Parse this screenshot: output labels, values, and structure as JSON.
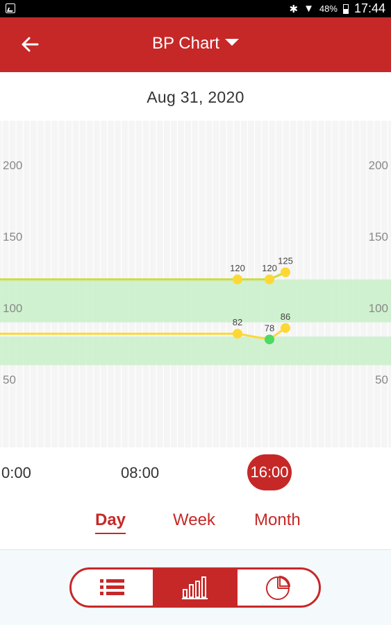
{
  "status_bar": {
    "battery": "48%",
    "time": "17:44"
  },
  "header": {
    "title": "BP Chart"
  },
  "date": "Aug 31, 2020",
  "chart_data": {
    "type": "line",
    "y_ticks": [
      200,
      150,
      100,
      50
    ],
    "ylim": [
      0,
      230
    ],
    "normal_bands": [
      [
        90,
        120
      ],
      [
        60,
        80
      ]
    ],
    "series": [
      {
        "values": [
          120,
          120,
          125
        ],
        "labels": [
          "120",
          "120",
          "125"
        ],
        "point_colors": [
          "#fdd835",
          "#fdd835",
          "#fdd835"
        ]
      },
      {
        "values": [
          82,
          78,
          86
        ],
        "labels": [
          "82",
          "78",
          "86"
        ],
        "point_colors": [
          "#fdd835",
          "#4cd964",
          "#fdd835"
        ]
      }
    ],
    "colors": {
      "systolic_line": "#cddc39",
      "diastolic_line": "#fdd835",
      "band": "#c8f0c8"
    }
  },
  "time_labels": [
    "0:00",
    "08:00",
    "16:00"
  ],
  "tabs": [
    "Day",
    "Week",
    "Month"
  ],
  "view_modes": [
    {
      "icon": "list-icon"
    },
    {
      "icon": "bar-chart-icon"
    },
    {
      "icon": "pie-chart-icon"
    }
  ],
  "colors": {
    "accent": "#c62828"
  }
}
